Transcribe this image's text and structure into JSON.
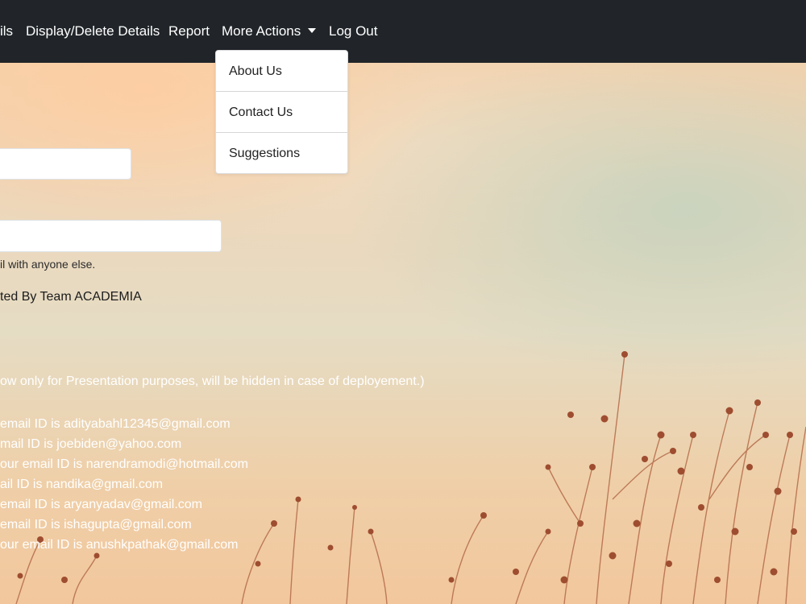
{
  "nav": {
    "items": [
      "ils",
      "Display/Delete Details",
      "Report",
      "More Actions",
      "Log Out"
    ]
  },
  "dropdown": {
    "items": [
      "About Us",
      "Contact Us",
      "Suggestions"
    ]
  },
  "form": {
    "field1_value": "",
    "field2_value": "",
    "help_text": "il with anyone else."
  },
  "credit": "ted By Team ACADEMIA",
  "note": "ow only for Presentation purposes, will be hidden in case of deployement.)",
  "emails": [
    "email ID is adityabahl12345@gmail.com",
    "mail ID is joebiden@yahoo.com",
    "our email ID is narendramodi@hotmail.com",
    "ail ID is nandika@gmail.com",
    " email ID is aryanyadav@gmail.com",
    "email ID is ishagupta@gmail.com",
    "our email ID is anushkpathak@gmail.com"
  ],
  "colors": {
    "navbar": "#212529",
    "flower": "#a4583a"
  }
}
